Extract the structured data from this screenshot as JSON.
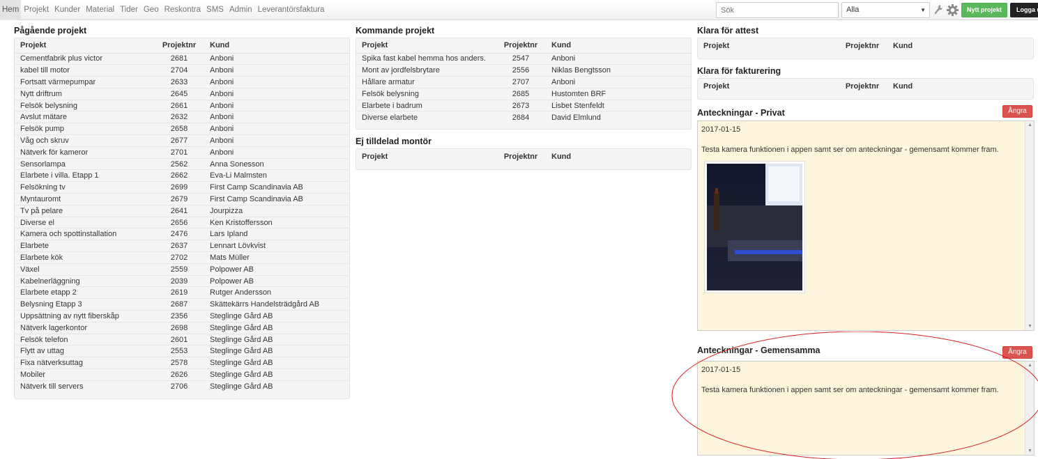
{
  "nav": {
    "items": [
      "Hem",
      "Projekt",
      "Kunder",
      "Material",
      "Tider",
      "Geo",
      "Reskontra",
      "SMS",
      "Admin",
      "Leverantörsfaktura"
    ],
    "search_placeholder": "Sök",
    "filter_value": "Alla",
    "new_project_label": "Nytt projekt",
    "logout_label": "Logga ut"
  },
  "columns": {
    "project": "Projekt",
    "number": "Projektnr",
    "customer": "Kund"
  },
  "ongoing": {
    "title": "Pågående projekt",
    "rows": [
      [
        "Cementfabrik plus victor",
        "2681",
        "Anboni"
      ],
      [
        "kabel till motor",
        "2704",
        "Anboni"
      ],
      [
        "Fortsatt värmepumpar",
        "2633",
        "Anboni"
      ],
      [
        "Nytt driftrum",
        "2645",
        "Anboni"
      ],
      [
        "Felsök belysning",
        "2661",
        "Anboni"
      ],
      [
        "Avslut mätare",
        "2632",
        "Anboni"
      ],
      [
        "Felsök pump",
        "2658",
        "Anboni"
      ],
      [
        "Våg och skruv",
        "2677",
        "Anboni"
      ],
      [
        "Nätverk för kameror",
        "2701",
        "Anboni"
      ],
      [
        "Sensorlampa",
        "2562",
        "Anna Sonesson"
      ],
      [
        "Elarbete i villa. Etapp 1",
        "2662",
        "Eva-Li Malmsten"
      ],
      [
        "Felsökning tv",
        "2699",
        "First Camp Scandinavia AB"
      ],
      [
        "Myntauromt",
        "2679",
        "First Camp Scandinavia AB"
      ],
      [
        "Tv på pelare",
        "2641",
        "Jourpizza"
      ],
      [
        "Diverse el",
        "2656",
        "Ken Kristoffersson"
      ],
      [
        "Kamera och spottinstallation",
        "2476",
        "Lars Ipland"
      ],
      [
        "Elarbete",
        "2637",
        "Lennart Lövkvist"
      ],
      [
        "Elarbete kök",
        "2702",
        "Mats Müller"
      ],
      [
        "Växel",
        "2559",
        "Polpower AB"
      ],
      [
        "Kabelnerläggning",
        "2039",
        "Polpower AB"
      ],
      [
        "Elarbete etapp 2",
        "2619",
        "Rutger Andersson"
      ],
      [
        "Belysning Etapp 3",
        "2687",
        "Skättekärrs Handelsträdgård AB"
      ],
      [
        "Uppsättning av nytt fiberskåp",
        "2356",
        "Steglinge Gård AB"
      ],
      [
        "Nätverk lagerkontor",
        "2698",
        "Steglinge Gård AB"
      ],
      [
        "Felsök telefon",
        "2601",
        "Steglinge Gård AB"
      ],
      [
        "Flytt av uttag",
        "2553",
        "Steglinge Gård AB"
      ],
      [
        "Fixa nätverksuttag",
        "2578",
        "Steglinge Gård AB"
      ],
      [
        "Mobiler",
        "2626",
        "Steglinge Gård AB"
      ],
      [
        "Nätverk till servers",
        "2706",
        "Steglinge Gård AB"
      ]
    ]
  },
  "upcoming": {
    "title": "Kommande projekt",
    "rows": [
      [
        "Spika fast kabel hemma hos anders.",
        "2547",
        "Anboni"
      ],
      [
        "Mont av jordfelsbrytare",
        "2556",
        "Niklas Bengtsson"
      ],
      [
        "Hållare armatur",
        "2707",
        "Anboni"
      ],
      [
        "Felsök belysning",
        "2685",
        "Hustomten BRF"
      ],
      [
        "Elarbete i badrum",
        "2673",
        "Lisbet Stenfeldt"
      ],
      [
        "Diverse elarbete",
        "2684",
        "David Elmlund"
      ]
    ]
  },
  "unassigned": {
    "title": "Ej tilldelad montör"
  },
  "attest": {
    "title": "Klara för attest"
  },
  "invoicing": {
    "title": "Klara för fakturering"
  },
  "notes_private": {
    "title": "Anteckningar - Privat",
    "undo_label": "Ångra",
    "date": "2017-01-15",
    "text": "Testa kamera funktionen i appen samt ser om anteckningar - gemensamt kommer fram."
  },
  "notes_shared": {
    "title": "Anteckningar - Gemensamma",
    "undo_label": "Ångra",
    "date": "2017-01-15",
    "text": "Testa kamera funktionen i appen samt ser om anteckningar - gemensamt kommer fram."
  },
  "colors": {
    "accent_green": "#5cb85c",
    "danger_red": "#d9534f",
    "annotation_red": "#d62020",
    "note_bg": "#fdf6dc"
  }
}
